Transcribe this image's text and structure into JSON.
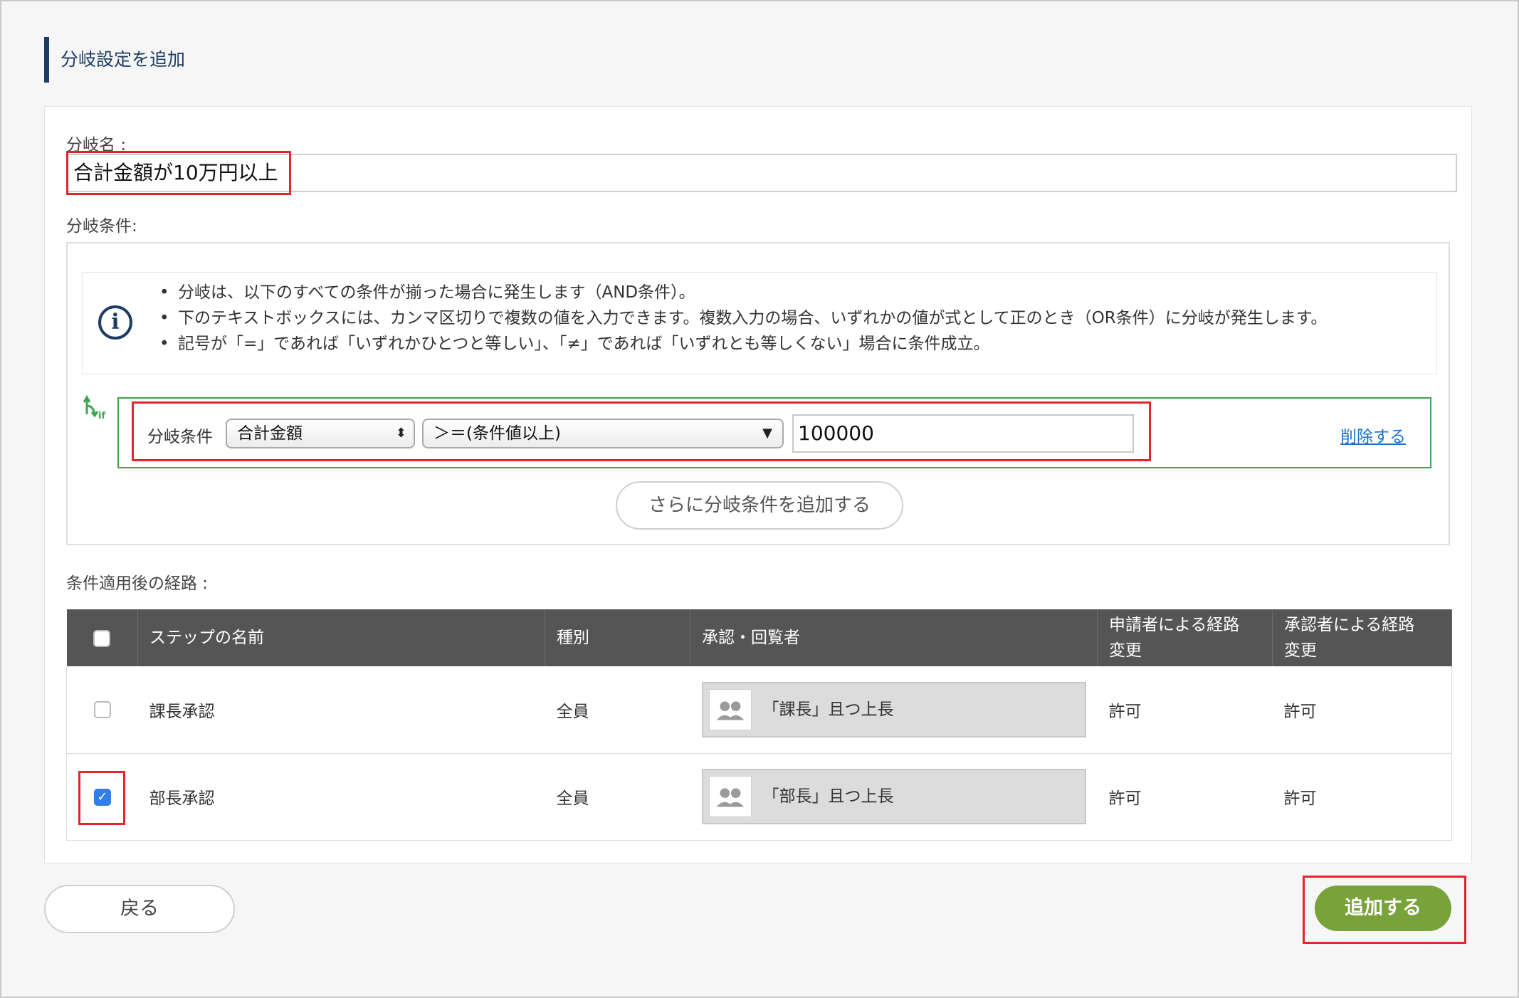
{
  "page": {
    "title": "分岐設定を追加"
  },
  "branch_name": {
    "label": "分岐名 :",
    "value": "合計金額が10万円以上"
  },
  "conditions": {
    "label": "分岐条件:",
    "info": [
      "分岐は、以下のすべての条件が揃った場合に発生します（AND条件）。",
      "下のテキストボックスには、カンマ区切りで複数の値を入力できます。複数入力の場合、いずれかの値が式として正のとき（OR条件）に分岐が発生します。",
      "記号が「=」であれば「いずれかひとつと等しい」、「≠」であれば「いずれとも等しくない」場合に条件成立。"
    ],
    "row": {
      "label": "分岐条件",
      "field": "合計金額",
      "operator": "＞＝(条件値以上)",
      "value": "100000",
      "delete": "削除する"
    },
    "add_button": "さらに分岐条件を追加する"
  },
  "route": {
    "label": "条件適用後の経路 :",
    "headers": [
      "ステップの名前",
      "種別",
      "承認・回覧者",
      "申請者による経路変更",
      "承認者による経路変更"
    ],
    "header_lines": {
      "applicant": [
        "申請者による経路",
        "変更"
      ],
      "approver": [
        "承認者による経路",
        "変更"
      ]
    },
    "rows": [
      {
        "name": "課長承認",
        "type": "全員",
        "approver": "「課長」且つ上長",
        "by_applicant": "許可",
        "by_approver": "許可",
        "checked": false
      },
      {
        "name": "部長承認",
        "type": "全員",
        "approver": "「部長」且つ上長",
        "by_applicant": "許可",
        "by_approver": "許可",
        "checked": true
      }
    ]
  },
  "buttons": {
    "back": "戻る",
    "submit": "追加する"
  },
  "colors": {
    "accent_navy": "#1d3d63",
    "condition_green": "#3ba44c",
    "submit_green": "#78a23a",
    "highlight_red": "#e2262d",
    "link_blue": "#1a73c9"
  }
}
